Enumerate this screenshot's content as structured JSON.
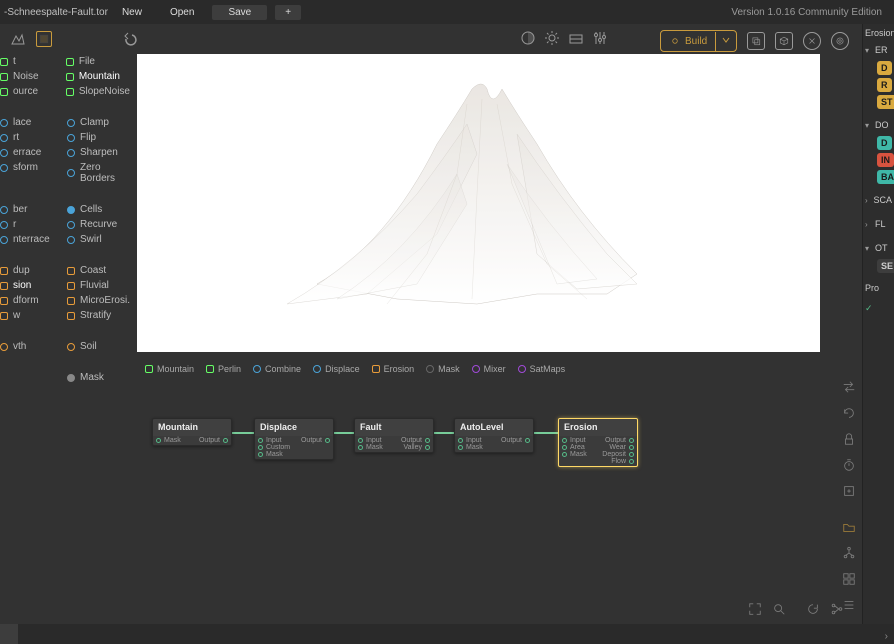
{
  "topbar": {
    "filename": "-Schneespalte-Fault.tor",
    "new": "New",
    "open": "Open",
    "save": "Save",
    "plus": "+",
    "version": "Version 1.0.16 Community Edition"
  },
  "sidebar": {
    "g1_left": [
      "t",
      "Noise",
      "ource"
    ],
    "g1_right": [
      "File",
      "Mountain",
      "SlopeNoise"
    ],
    "g2_left": [
      "lace",
      "rt",
      "errace",
      "sform"
    ],
    "g2_right": [
      "Clamp",
      "Flip",
      "Sharpen",
      "Zero Borders"
    ],
    "g3_left": [
      "ber",
      "r",
      "nterrace"
    ],
    "g3_right": [
      "Cells",
      "Recurve",
      "Swirl"
    ],
    "g4_left": [
      "dup",
      "sion",
      "dform",
      "w"
    ],
    "g4_right": [
      "Coast",
      "Fluvial",
      "MicroErosi.",
      "Stratify"
    ],
    "g5_left": [
      "vth"
    ],
    "g5_right": [
      "Soil"
    ],
    "g6_right": [
      "Mask"
    ]
  },
  "nodebar": [
    "Mountain",
    "Perlin",
    "Combine",
    "Displace",
    "Erosion",
    "Mask",
    "Mixer",
    "SatMaps"
  ],
  "nodes": [
    {
      "title": "Mountain",
      "in": [
        "Mask"
      ],
      "out": [
        "Output"
      ]
    },
    {
      "title": "Displace",
      "in": [
        "Input",
        "Custom",
        "Mask"
      ],
      "out": [
        "Output"
      ]
    },
    {
      "title": "Fault",
      "in": [
        "Input",
        "Mask"
      ],
      "out": [
        "Output",
        "Valley"
      ]
    },
    {
      "title": "AutoLevel",
      "in": [
        "Input",
        "Mask"
      ],
      "out": [
        "Output"
      ]
    },
    {
      "title": "Erosion",
      "in": [
        "Input",
        "Area",
        "Mask"
      ],
      "out": [
        "Output",
        "Wear",
        "Deposit",
        "Flow"
      ]
    }
  ],
  "build": {
    "label": "Build"
  },
  "props": {
    "title": "Erosion",
    "sects": [
      "ER",
      "DO",
      "SCA",
      "FL",
      "OT"
    ],
    "chips_er": [
      "D",
      "R",
      "ST"
    ],
    "chips_do": [
      "D",
      "IN",
      "BA"
    ],
    "chips_ot": [
      "SE"
    ],
    "pro": "Pro"
  }
}
